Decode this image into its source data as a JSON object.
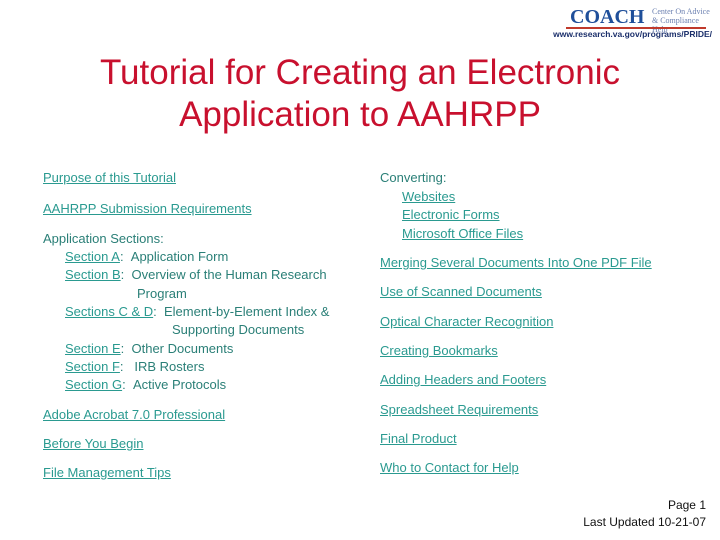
{
  "logo": {
    "name": "COACH",
    "subtitle_line1": "Center On Advice",
    "subtitle_line2": "& Compliance Help",
    "url": "www.research.va.gov/programs/PRIDE/"
  },
  "title": {
    "line1": "Tutorial for Creating an Electronic",
    "line2": "Application to AAHRPP"
  },
  "left": {
    "purpose": "Purpose of this Tutorial",
    "submission": "AAHRPP Submission Requirements",
    "app_sections_label": "Application Sections:",
    "sections": [
      {
        "link": "Section A",
        "desc": "Application Form"
      },
      {
        "link": "Section B",
        "desc": "Overview of the Human Research",
        "desc2": "Program"
      },
      {
        "link": "Sections C & D",
        "desc": "Element-by-Element Index &",
        "desc2": "Supporting Documents"
      },
      {
        "link": "Section E",
        "desc": "Other Documents"
      },
      {
        "link": "Section F",
        "desc": " IRB Rosters"
      },
      {
        "link": "Section G",
        "desc": "Active Protocols"
      }
    ],
    "acrobat": "Adobe Acrobat 7.0 Professional",
    "before": "Before You Begin",
    "file_mgmt": "File Management Tips"
  },
  "right": {
    "converting_label": "Converting:",
    "converting": [
      "Websites",
      "Electronic Forms",
      "Microsoft Office Files"
    ],
    "links": [
      "Merging Several Documents Into One PDF File",
      "Use of Scanned Documents",
      "Optical Character Recognition",
      "Creating Bookmarks",
      "Adding Headers and Footers",
      "Spreadsheet Requirements",
      "Final Product",
      "Who to Contact for Help"
    ]
  },
  "footer": {
    "page": "Page 1",
    "updated": "Last Updated 10-21-07"
  }
}
